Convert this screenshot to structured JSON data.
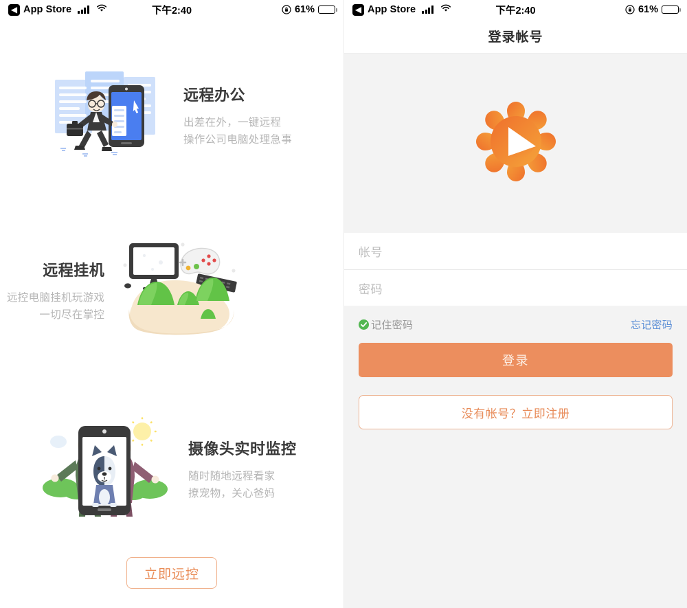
{
  "status_bar": {
    "back_glyph": "◀",
    "carrier_label": "App Store",
    "time": "下午2:40",
    "battery_percent": "61%",
    "battery_level": 61,
    "signal_icon": "cellular-signal-icon",
    "wifi_icon": "wifi-icon",
    "rotation_lock_icon": "rotation-lock-icon",
    "battery_icon": "battery-icon"
  },
  "left_panel": {
    "features": [
      {
        "title": "远程办公",
        "sub_line1": "出差在外，一键远程",
        "sub_line2": "操作公司电脑处理急事",
        "illustration": "businessman-running-with-phone-illustration"
      },
      {
        "title": "远程挂机",
        "sub_line1": "远控电脑挂机玩游戏",
        "sub_line2": "一切尽在掌控",
        "illustration": "hand-holding-hills-with-gaming-devices-illustration"
      },
      {
        "title": "摄像头实时监控",
        "sub_line1": "随时随地远程看家",
        "sub_line2": "撩宠物，关心爸妈",
        "illustration": "elderly-couple-with-dog-behind-phone-illustration"
      }
    ],
    "cta_label": "立即远控"
  },
  "right_panel": {
    "nav_title": "登录帐号",
    "logo_icon": "sunflower-play-logo",
    "account_placeholder": "帐号",
    "account_value": "",
    "password_placeholder": "密码",
    "password_value": "",
    "remember_label": "记住密码",
    "remember_checked": true,
    "remember_icon": "check-circle-icon",
    "forgot_label": "忘记密码",
    "login_label": "登录",
    "register_label": "没有帐号？立即注册"
  },
  "colors": {
    "accent_orange": "#ec8e5e",
    "accent_orange_border": "#edb392",
    "link_blue": "#5c8fd6",
    "check_green": "#52b751",
    "panel_bg": "#f3f3f3",
    "title_gray": "#3a3a3a",
    "sub_gray": "#b6b6b6"
  }
}
